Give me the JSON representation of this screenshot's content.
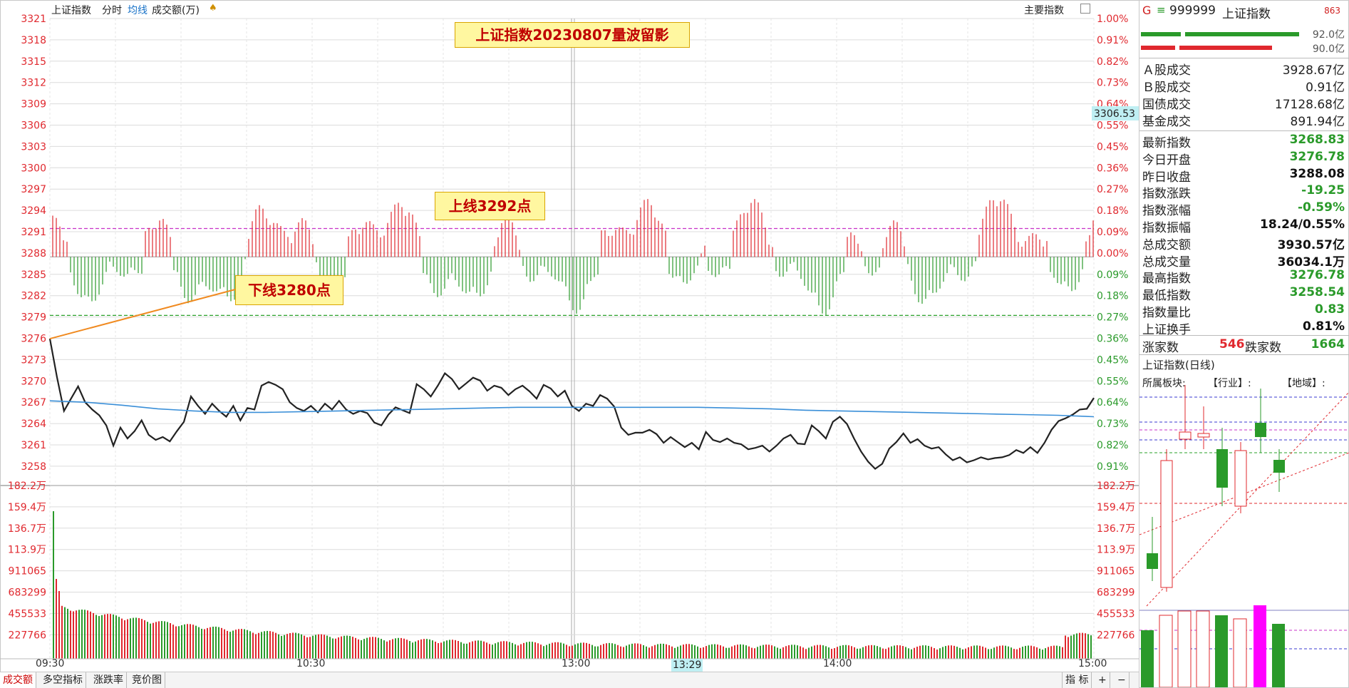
{
  "topbar": {
    "index_name": "上证指数",
    "tab_intraday": "分时",
    "tab_avgline": "均线",
    "tab_volume": "成交额(万)",
    "main_index_label": "主要指数"
  },
  "annotations": {
    "title": "上证指数20230807量波留影",
    "upper_line": "上线3292点",
    "lower_line": "下线3280点"
  },
  "price_axis": {
    "left_labels": [
      "3321",
      "3318",
      "3315",
      "3312",
      "3309",
      "3306",
      "3303",
      "3300",
      "3297",
      "3294",
      "3291",
      "3288",
      "3285",
      "3282",
      "3279",
      "3276",
      "3273",
      "3270",
      "3267",
      "3264",
      "3261",
      "3258"
    ],
    "right_labels": [
      "1.00%",
      "0.91%",
      "0.82%",
      "0.73%",
      "0.64%",
      "0.55%",
      "0.45%",
      "0.36%",
      "0.27%",
      "0.18%",
      "0.09%",
      "0.00%",
      "0.09%",
      "0.18%",
      "0.27%",
      "0.36%",
      "0.45%",
      "0.55%",
      "0.64%",
      "0.73%",
      "0.82%",
      "0.91%"
    ],
    "cursor_value": "3306.53"
  },
  "volume_axis": {
    "left_labels": [
      "182.2万",
      "159.4万",
      "136.7万",
      "113.9万",
      "911065",
      "683299",
      "455533",
      "227766"
    ],
    "right_labels": [
      "182.2万",
      "159.4万",
      "136.7万",
      "113.9万",
      "911065",
      "683299",
      "455533",
      "227766"
    ]
  },
  "time_axis": {
    "labels": [
      "09:30",
      "10:30",
      "13:00",
      "14:00",
      "15:00"
    ],
    "cursor_time": "13:29"
  },
  "colors": {
    "up": "#e0282e",
    "down": "#2a9a2a",
    "price_line": "#222222",
    "avg_line": "#3a8fd8",
    "upper_dash": "#c832c8",
    "lower_dash": "#2aa02a",
    "annotation_bg": "#fff7a0"
  },
  "chart_data": {
    "type": "line",
    "series": [
      {
        "values": [
          3276.78,
          3271.5,
          3266.8,
          3268.5,
          3270.2,
          3268.0,
          3267.0,
          3266.2,
          3264.8,
          3262.0,
          3264.5,
          3263.0,
          3264.0,
          3265.5,
          3263.5,
          3262.8,
          3263.2,
          3262.6,
          3264.0,
          3265.3,
          3268.8,
          3267.5,
          3266.4,
          3267.8,
          3266.8,
          3266.0,
          3267.5,
          3265.5,
          3267.2,
          3267.0,
          3270.3,
          3270.8,
          3270.4,
          3269.8,
          3268.0,
          3267.2,
          3266.8,
          3267.5,
          3266.6,
          3267.8,
          3267.0,
          3268.2,
          3267.0,
          3266.4,
          3266.8,
          3266.5,
          3265.2,
          3264.8,
          3266.3,
          3267.3,
          3266.9,
          3266.5,
          3270.5,
          3269.8,
          3268.8,
          3270.3,
          3272.0,
          3271.2,
          3269.8,
          3270.6,
          3271.4,
          3271.0,
          3269.6,
          3270.3,
          3270.0,
          3269.0,
          3269.8,
          3270.3,
          3269.5,
          3268.5,
          3270.4,
          3269.9,
          3268.8,
          3269.6,
          3267.5,
          3266.8,
          3267.8,
          3267.5,
          3269.0,
          3268.5,
          3267.4,
          3264.5,
          3263.5,
          3263.8,
          3263.8,
          3264.2,
          3263.6,
          3262.4,
          3263.2,
          3262.5,
          3261.8,
          3262.4,
          3261.5,
          3263.9,
          3262.8,
          3262.5,
          3263.0,
          3262.4,
          3262.2,
          3261.5,
          3261.7,
          3262.0,
          3261.2,
          3262.0,
          3263.0,
          3263.5,
          3262.3,
          3262.2,
          3264.8,
          3264.0,
          3263.0,
          3265.3,
          3266.0,
          3265.0,
          3263.0,
          3261.2,
          3259.8,
          3258.8,
          3259.5,
          3261.6,
          3262.5,
          3263.7,
          3262.4,
          3262.9,
          3262.0,
          3261.6,
          3261.8,
          3260.8,
          3260.0,
          3260.4,
          3259.7,
          3260.0,
          3260.4,
          3260.1,
          3260.3,
          3260.4,
          3260.7,
          3261.4,
          3261.0,
          3261.8,
          3261.0,
          3262.4,
          3264.2,
          3265.4,
          3265.8,
          3266.3,
          3267.0,
          3267.1,
          3268.6
        ]
      },
      {
        "values": [
          3268.2,
          3268.0,
          3267.6,
          3267.1,
          3266.8,
          3266.6,
          3266.6,
          3266.7,
          3266.8,
          3266.9,
          3267.0,
          3267.1,
          3267.2,
          3267.3,
          3267.3,
          3267.3,
          3267.3,
          3267.3,
          3267.3,
          3267.2,
          3267.1,
          3266.9,
          3266.8,
          3266.7,
          3266.6,
          3266.5,
          3266.4,
          3266.3,
          3266.2,
          3266.0
        ]
      }
    ],
    "ylim": [
      3256.5,
      3321
    ],
    "upper_line": 3292,
    "lower_line": 3280,
    "prev_close": 3288.08
  },
  "right_panel": {
    "header": {
      "g": "G",
      "code": "999999",
      "name": "上证指数",
      "num": "863"
    },
    "header_vals": [
      "92.0亿",
      "90.0亿"
    ],
    "turnover": [
      {
        "k": "Ａ股成交",
        "v": "3928.67亿"
      },
      {
        "k": "Ｂ股成交",
        "v": "0.91亿"
      },
      {
        "k": "国债成交",
        "v": "17128.68亿"
      },
      {
        "k": "基金成交",
        "v": "891.94亿"
      }
    ],
    "stats": [
      {
        "k": "最新指数",
        "v": "3268.83",
        "c": "g"
      },
      {
        "k": "今日开盘",
        "v": "3276.78",
        "c": "g"
      },
      {
        "k": "昨日收盘",
        "v": "3288.08",
        "c": "k"
      },
      {
        "k": "指数涨跌",
        "v": "-19.25",
        "c": "g"
      },
      {
        "k": "指数涨幅",
        "v": "-0.59%",
        "c": "g"
      },
      {
        "k": "指数振幅",
        "v": "18.24/0.55%",
        "c": "k"
      },
      {
        "k": "总成交额",
        "v": "3930.57亿",
        "c": "k"
      },
      {
        "k": "总成交量",
        "v": "36034.1万",
        "c": "k"
      },
      {
        "k": "最高指数",
        "v": "3276.78",
        "c": "g"
      },
      {
        "k": "最低指数",
        "v": "3258.54",
        "c": "g"
      },
      {
        "k": "指数量比",
        "v": "0.83",
        "c": "g"
      },
      {
        "k": "上证换手",
        "v": "0.81%",
        "c": "k"
      }
    ],
    "breadth": {
      "up_label": "涨家数",
      "up": "546",
      "down_label": "跌家数",
      "down": "1664"
    },
    "mini_title": "上证指数(日线)",
    "mini_sector": "所属板块:",
    "mini_industry": "【行业】:",
    "mini_region": "【地域】:"
  },
  "bottom_tabs": [
    "成交额",
    "多空指标",
    "涨跌率",
    "竞价图"
  ],
  "bottom_right": {
    "index": "指 标",
    "plus": "+",
    "minus": "−"
  }
}
